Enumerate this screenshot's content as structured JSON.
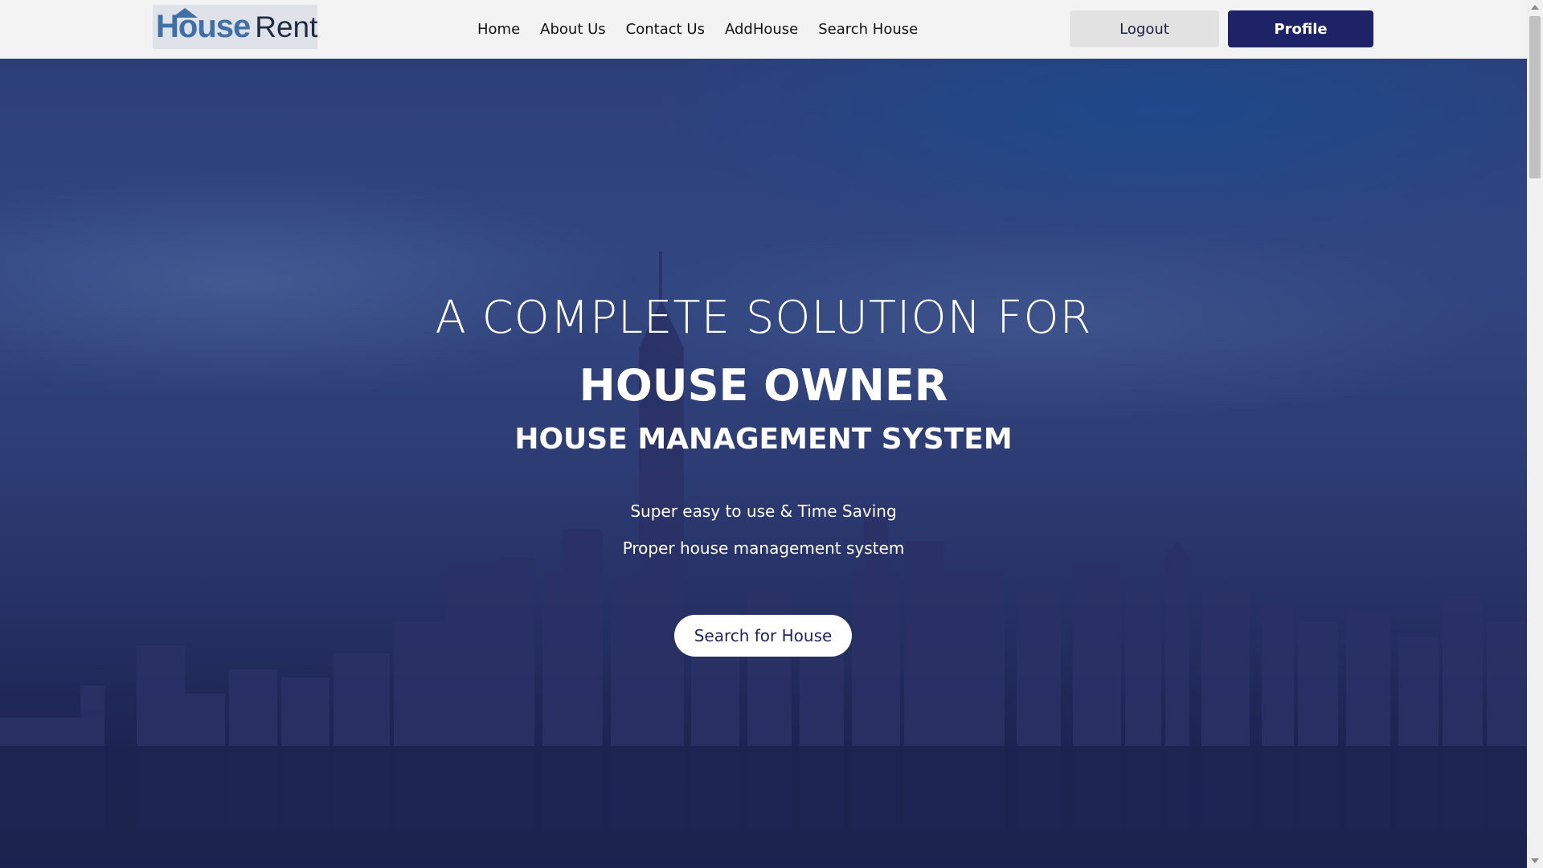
{
  "brand": {
    "logo_house": "House",
    "logo_rent": "Rent"
  },
  "nav": {
    "links": [
      {
        "label": "Home"
      },
      {
        "label": "About Us"
      },
      {
        "label": "Contact Us"
      },
      {
        "label": "AddHouse"
      },
      {
        "label": "Search House"
      }
    ],
    "logout_label": "Logout",
    "profile_label": "Profile"
  },
  "hero": {
    "line1": "A COMPLETE SOLUTION FOR",
    "line2": "HOUSE OWNER",
    "line3": "HOUSE MANAGEMENT SYSTEM",
    "tagline1": "Super easy to use & Time Saving",
    "tagline2": "Proper house management system",
    "cta_label": "Search for House"
  },
  "colors": {
    "navbar_bg": "#f4f3f3",
    "profile_button": "#1e2266",
    "logout_button": "#e2e2e2",
    "hero_overlay": "#2c3f7a",
    "logo_accent": "#3e6fa6"
  }
}
